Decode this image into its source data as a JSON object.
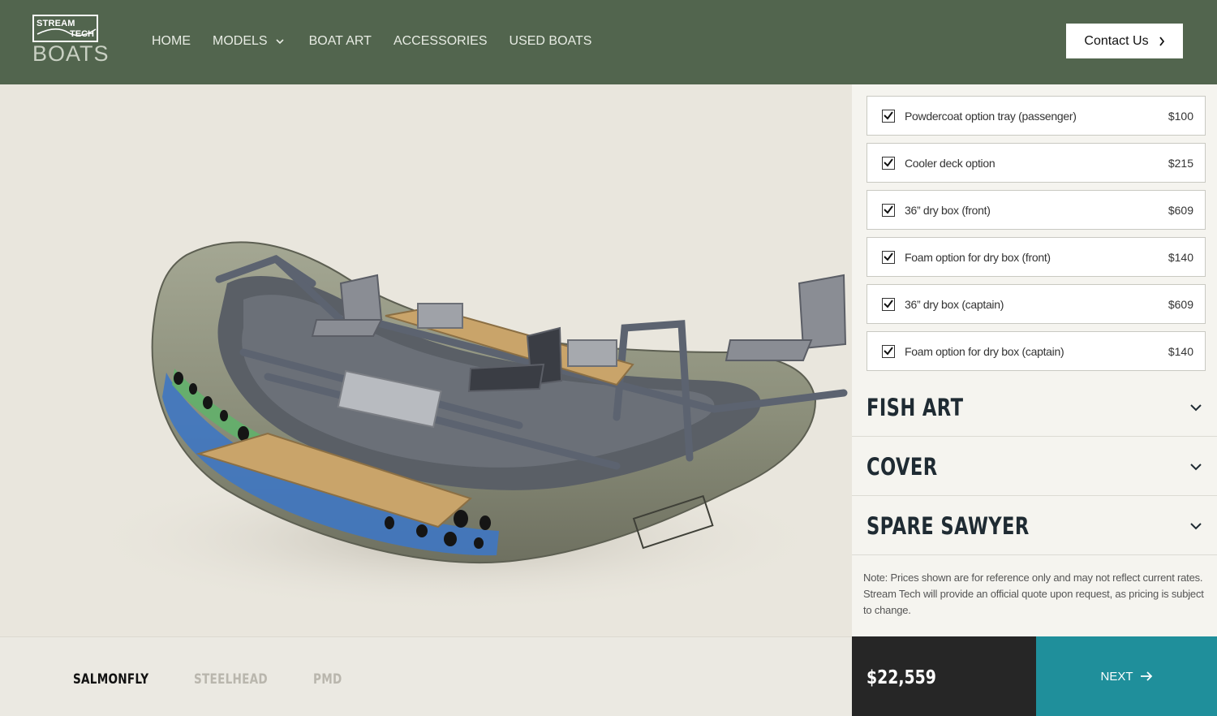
{
  "brand": {
    "stream": "STREAM",
    "tech": "TECH",
    "boats": "BOATS"
  },
  "nav": [
    {
      "label": "HOME"
    },
    {
      "label": "MODELS"
    },
    {
      "label": "BOAT ART"
    },
    {
      "label": "ACCESSORIES"
    },
    {
      "label": "USED BOATS"
    }
  ],
  "contact": {
    "label": "Contact Us"
  },
  "options": [
    {
      "label": "Powdercoat option tray (passenger)",
      "price": "$100",
      "checked": true
    },
    {
      "label": "Cooler deck option",
      "price": "$215",
      "checked": true
    },
    {
      "label": "36” dry box (front)",
      "price": "$609",
      "checked": true
    },
    {
      "label": "Foam option for dry box (front)",
      "price": "$140",
      "checked": true
    },
    {
      "label": "36” dry box (captain)",
      "price": "$609",
      "checked": true
    },
    {
      "label": "Foam option for dry box (captain)",
      "price": "$140",
      "checked": true
    }
  ],
  "sections": [
    {
      "title": "FISH ART"
    },
    {
      "title": "COVER"
    },
    {
      "title": "SPARE SAWYER"
    }
  ],
  "note": "Note: Prices shown are for reference only and may not reflect current rates. Stream Tech will provide an official quote upon request, as pricing is subject to change.",
  "variants": [
    {
      "label": "SALMONFLY",
      "active": true
    },
    {
      "label": "STEELHEAD",
      "active": false
    },
    {
      "label": "PMD",
      "active": false
    }
  ],
  "total": "$22,559",
  "next": {
    "label": "NEXT"
  },
  "colors": {
    "header": "#52654e",
    "accent": "#1f8f9b",
    "total_bg": "#262626",
    "background": "#e9e6dd"
  }
}
